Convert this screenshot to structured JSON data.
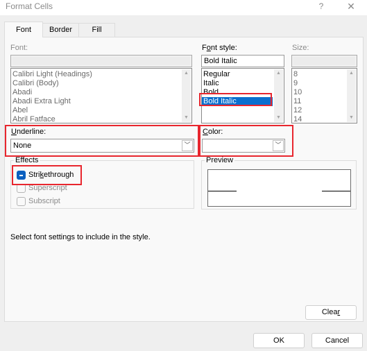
{
  "window": {
    "title": "Format Cells",
    "help_label": "?",
    "close_label": "✕"
  },
  "tabs": [
    {
      "label": "Font",
      "active": true
    },
    {
      "label": "Border",
      "active": false
    },
    {
      "label": "Fill",
      "active": false
    }
  ],
  "font": {
    "label": "Font:",
    "value": "",
    "items": [
      "Calibri Light (Headings)",
      "Calibri (Body)",
      "Abadi",
      "Abadi Extra Light",
      "Abel",
      "Abril Fatface"
    ]
  },
  "font_style": {
    "label_prefix": "F",
    "label_underlined": "o",
    "label_suffix": "nt style:",
    "value": "Bold Italic",
    "items": [
      "Regular",
      "Italic",
      "Bold",
      "Bold Italic"
    ],
    "selected": "Bold Italic"
  },
  "size": {
    "label": "Size:",
    "value": "",
    "items": [
      "8",
      "9",
      "10",
      "11",
      "12",
      "14"
    ]
  },
  "underline": {
    "label_underlined": "U",
    "label_suffix": "nderline:",
    "value": "None"
  },
  "color": {
    "label_underlined": "C",
    "label_suffix": "olor:",
    "value": ""
  },
  "effects": {
    "title": "Effects",
    "strikethrough": {
      "pre": "Stri",
      "u": "k",
      "post": "ethrough",
      "state": "indeterminate"
    },
    "superscript": {
      "label": "Superscript",
      "checked": false
    },
    "subscript": {
      "label": "Subscript",
      "checked": false
    }
  },
  "preview": {
    "title": "Preview"
  },
  "help_text": "Select font settings to include in the style.",
  "buttons": {
    "clear_pre": "Clea",
    "clear_u": "r",
    "ok": "OK",
    "cancel": "Cancel"
  },
  "icons": {
    "scroll_up": "▲",
    "scroll_down": "▼",
    "dropdown": "﹀"
  },
  "colors": {
    "selection": "#0a6fcf",
    "highlight_box": "#e8262e",
    "checkbox_accent": "#0a5fbf"
  }
}
